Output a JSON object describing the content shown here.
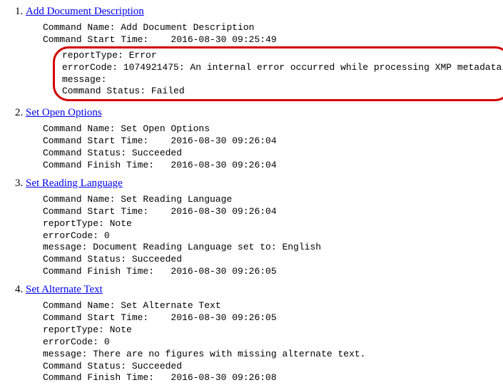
{
  "items": [
    {
      "num": "1.",
      "link": "Add Document Description",
      "pre": "Command Name: Add Document Description\nCommand Start Time:    2016-08-30 09:25:49",
      "boxed": "reportType: Error\nerrorCode: 1074921475: An internal error occurred while processing XMP metadata\nmessage:\nCommand Status: Failed",
      "post": ""
    },
    {
      "num": "2.",
      "link": "Set Open Options",
      "pre": "Command Name: Set Open Options\nCommand Start Time:    2016-08-30 09:26:04\nCommand Status: Succeeded\nCommand Finish Time:   2016-08-30 09:26:04",
      "boxed": "",
      "post": ""
    },
    {
      "num": "3.",
      "link": "Set Reading Language",
      "pre": "Command Name: Set Reading Language\nCommand Start Time:    2016-08-30 09:26:04\nreportType: Note\nerrorCode: 0\nmessage: Document Reading Language set to: English\nCommand Status: Succeeded\nCommand Finish Time:   2016-08-30 09:26:05",
      "boxed": "",
      "post": ""
    },
    {
      "num": "4.",
      "link": "Set Alternate Text",
      "pre": "Command Name: Set Alternate Text\nCommand Start Time:    2016-08-30 09:26:05\nreportType: Note\nerrorCode: 0\nmessage: There are no figures with missing alternate text.\nCommand Status: Succeeded\nCommand Finish Time:   2016-08-30 09:26:08",
      "boxed": "",
      "post": ""
    }
  ]
}
